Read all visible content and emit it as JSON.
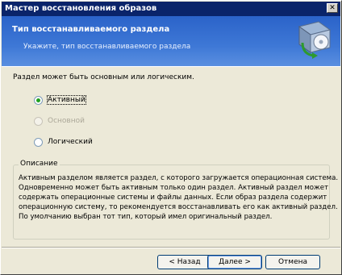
{
  "window": {
    "title": "Мастер восстановления образов",
    "close_glyph": "✕"
  },
  "header": {
    "title": "Тип восстанавливаемого раздела",
    "subtitle": "Укажите, тип восстанавливаемого раздела",
    "icon": "restore-drive-icon"
  },
  "prompt": "Раздел может быть основным или логическим.",
  "options": [
    {
      "label": "Активный",
      "selected": true,
      "enabled": true
    },
    {
      "label": "Основной",
      "selected": false,
      "enabled": false
    },
    {
      "label": "Логический",
      "selected": false,
      "enabled": true
    }
  ],
  "description": {
    "legend": "Описание",
    "lines": [
      "Активным разделом является раздел, с которого загружается операционная система.",
      "Одновременно может быть активным только один раздел. Активный раздел может",
      "содержать операционные системы и файлы данных. Если образ раздела содержит",
      "операционную систему, то рекомендуется восстанавливать его как активный раздел.",
      "По умолчанию выбран тот тип, который имел оригинальный раздел."
    ]
  },
  "buttons": {
    "back": "< Назад",
    "next": "Далее >",
    "cancel": "Отмена"
  },
  "colors": {
    "titlebar": "#0a246a",
    "header": "#3e78d6",
    "radio_check": "#20a020"
  }
}
